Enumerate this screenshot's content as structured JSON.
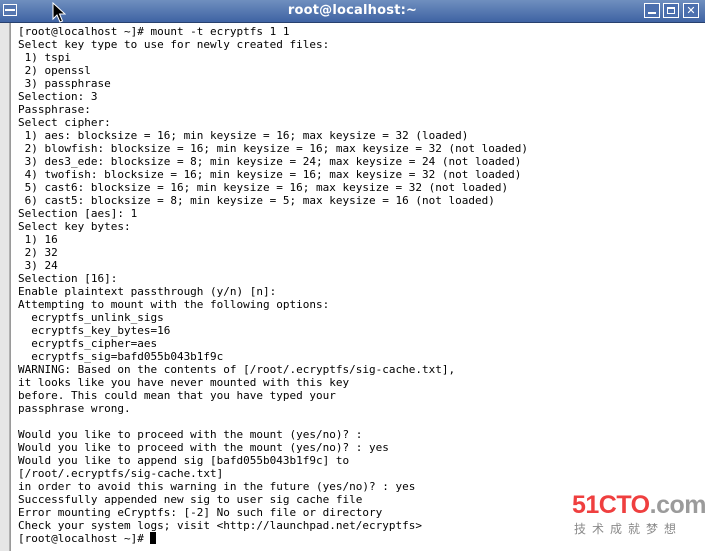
{
  "window": {
    "title": "root@localhost:~",
    "minimize_label": "_",
    "maximize_label": "",
    "close_label": "✕"
  },
  "terminal": {
    "lines": [
      "[root@localhost ~]# mount -t ecryptfs 1 1",
      "Select key type to use for newly created files:",
      " 1) tspi",
      " 2) openssl",
      " 3) passphrase",
      "Selection: 3",
      "Passphrase:",
      "Select cipher:",
      " 1) aes: blocksize = 16; min keysize = 16; max keysize = 32 (loaded)",
      " 2) blowfish: blocksize = 16; min keysize = 16; max keysize = 32 (not loaded)",
      " 3) des3_ede: blocksize = 8; min keysize = 24; max keysize = 24 (not loaded)",
      " 4) twofish: blocksize = 16; min keysize = 16; max keysize = 32 (not loaded)",
      " 5) cast6: blocksize = 16; min keysize = 16; max keysize = 32 (not loaded)",
      " 6) cast5: blocksize = 8; min keysize = 5; max keysize = 16 (not loaded)",
      "Selection [aes]: 1",
      "Select key bytes:",
      " 1) 16",
      " 2) 32",
      " 3) 24",
      "Selection [16]:",
      "Enable plaintext passthrough (y/n) [n]:",
      "Attempting to mount with the following options:",
      "  ecryptfs_unlink_sigs",
      "  ecryptfs_key_bytes=16",
      "  ecryptfs_cipher=aes",
      "  ecryptfs_sig=bafd055b043b1f9c",
      "WARNING: Based on the contents of [/root/.ecryptfs/sig-cache.txt],",
      "it looks like you have never mounted with this key",
      "before. This could mean that you have typed your",
      "passphrase wrong.",
      "",
      "Would you like to proceed with the mount (yes/no)? :",
      "Would you like to proceed with the mount (yes/no)? : yes",
      "Would you like to append sig [bafd055b043b1f9c] to",
      "[/root/.ecryptfs/sig-cache.txt]",
      "in order to avoid this warning in the future (yes/no)? : yes",
      "Successfully appended new sig to user sig cache file",
      "Error mounting eCryptfs: [-2] No such file or directory",
      "Check your system logs; visit <http://launchpad.net/ecryptfs>"
    ],
    "prompt": "[root@localhost ~]# "
  },
  "watermark": {
    "logo_red": "51CTO",
    "logo_gray": ".com",
    "subtitle": "技术成就梦想"
  },
  "colors": {
    "titlebar": "#3f63a3",
    "terminal_bg": "#ffffff",
    "terminal_fg": "#000000",
    "watermark_red": "#ef3f3f"
  }
}
